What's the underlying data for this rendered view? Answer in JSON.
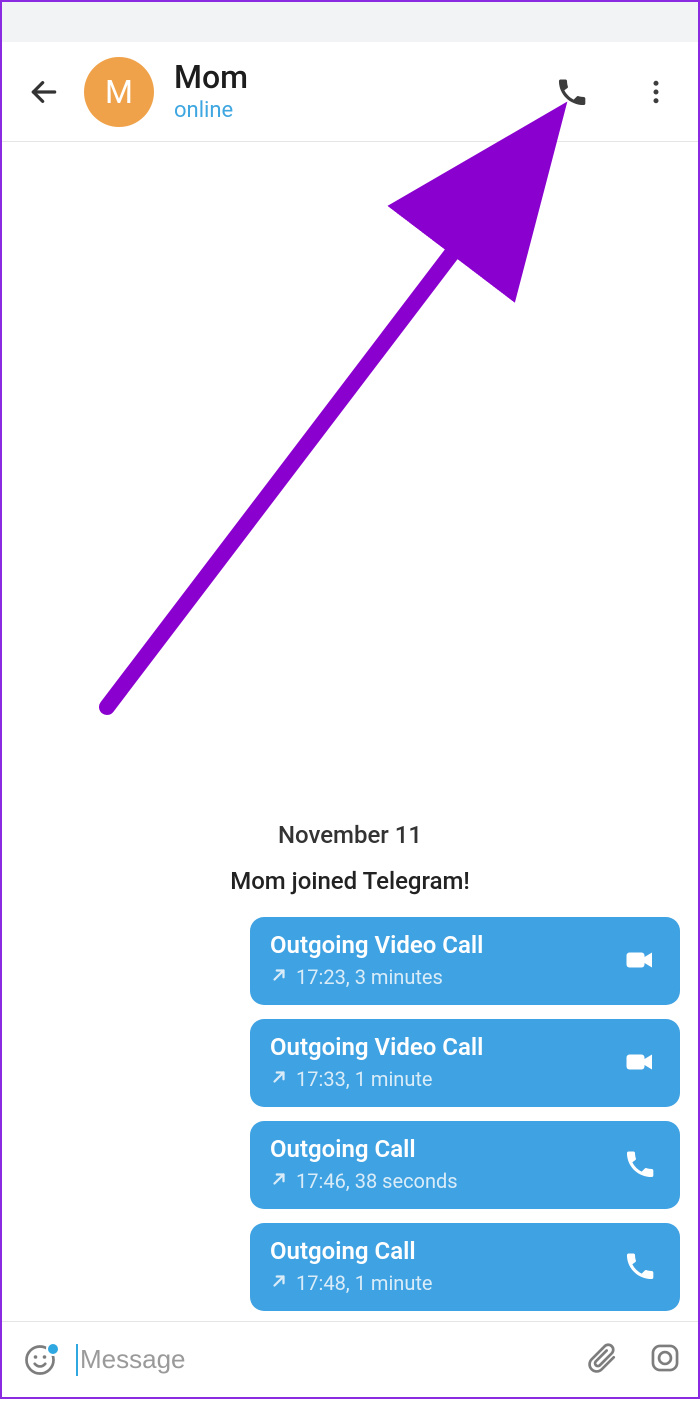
{
  "header": {
    "avatar_initial": "M",
    "contact_name": "Mom",
    "status": "online"
  },
  "chat": {
    "date_label": "November 11",
    "system_message": "Mom joined Telegram!",
    "calls": [
      {
        "title": "Outgoing Video Call",
        "meta": "17:23, 3 minutes",
        "icon": "video"
      },
      {
        "title": "Outgoing Video Call",
        "meta": "17:33, 1 minute",
        "icon": "video"
      },
      {
        "title": "Outgoing Call",
        "meta": "17:46, 38 seconds",
        "icon": "phone"
      },
      {
        "title": "Outgoing Call",
        "meta": "17:48, 1 minute",
        "icon": "phone"
      }
    ]
  },
  "input": {
    "placeholder": "Message"
  }
}
